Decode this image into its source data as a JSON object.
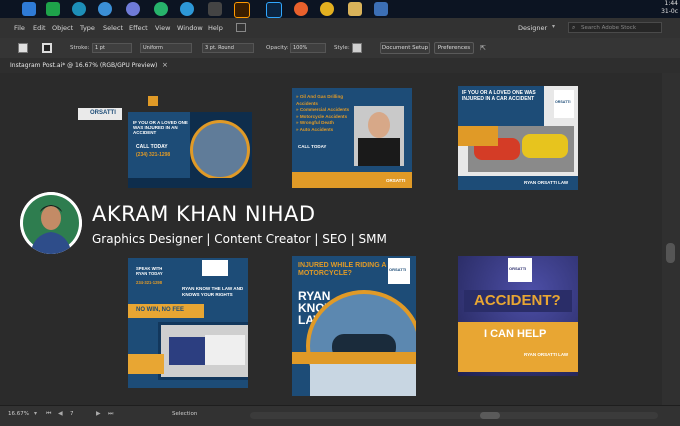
{
  "taskbar": {
    "clock_time": "1:44",
    "clock_date": "31-0c"
  },
  "menubar": {
    "items": [
      "File",
      "Edit",
      "Object",
      "Type",
      "Select",
      "Effect",
      "View",
      "Window",
      "Help"
    ],
    "workspace": "Designer",
    "search_placeholder": "Search Adobe Stock"
  },
  "controlbar": {
    "stroke_label": "Stroke:",
    "stroke_weight": "1 pt",
    "uniform_label": "Uniform",
    "brush_label": "3 pt. Round",
    "opacity_label": "Opacity:",
    "opacity_value": "100%",
    "style_label": "Style:",
    "doc_setup": "Document Setup",
    "preferences": "Preferences"
  },
  "document": {
    "tab_label": "Instagram Post.ai* @ 16.67% (RGB/GPU Preview)",
    "close": "×"
  },
  "statusbar": {
    "zoom": "16.67%",
    "artboard_num": "7",
    "tool": "Selection"
  },
  "profile": {
    "name": "AKRAM KHAN NIHAD",
    "tagline": "Graphics Designer | Content Creator | SEO | SMM"
  },
  "artboards": {
    "ab1": {
      "brand": "ORSATTI",
      "headline": "IF YOU OR A LOVED ONE WAS INJURED IN AN ACCIDENT",
      "cta": "CALL TODAY",
      "phone": "(234) 321-1298"
    },
    "ab2": {
      "bullets": [
        "» Oil And Gas Drilling Accidents",
        "» Commercial Accidents",
        "» Motorcycle Accidents",
        "» Wrongful Death",
        "» Auto Accidents"
      ],
      "cta": "CALL TODAY",
      "brand": "ORSATTI"
    },
    "ab3": {
      "headline": "IF YOU OR A LOVED ONE WAS INJURED IN A CAR ACCIDENT",
      "brand": "ORSATTI",
      "footer": "RYAN ORSATTI LAW"
    },
    "ab4": {
      "top": "SPEAK WITH RYAN TODAY",
      "phone": "234-321-1298",
      "headline": "RYAN KNOW THE LAW AND KNOWS YOUR RIGHTS",
      "banner": "NO WIN, NO FEE"
    },
    "ab5": {
      "headline": "INJURED WHILE RIDING A MOTORCYCLE?",
      "sub": "RYAN KNOWS LAW",
      "brand": "ORSATTI"
    },
    "ab6": {
      "brand": "ORSATTI",
      "headline": "ACCIDENT?",
      "sub": "I CAN HELP",
      "footer": "RYAN ORSATTI LAW"
    }
  }
}
